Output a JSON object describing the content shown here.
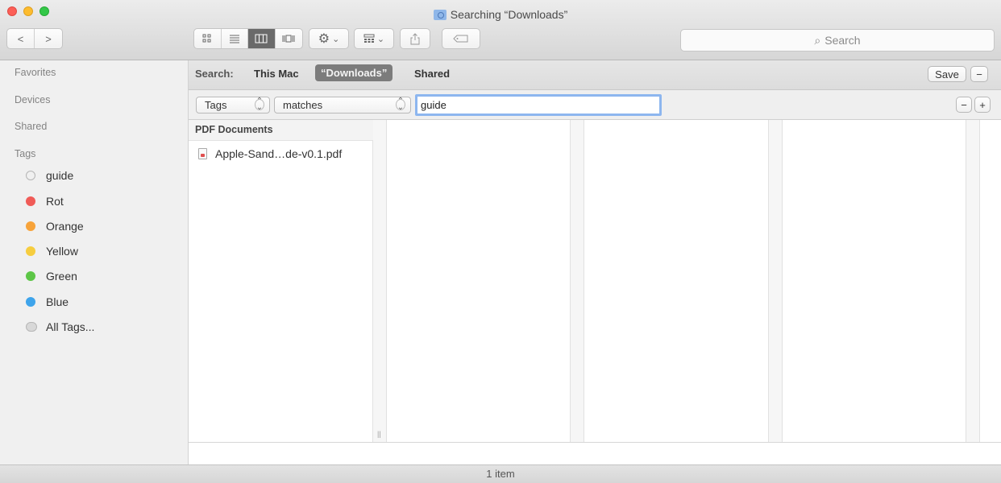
{
  "window": {
    "title": "Searching “Downloads”"
  },
  "toolbar": {
    "back_icon": "<",
    "forward_icon": ">",
    "view_icons": [
      "icon-view-icon",
      "list-view-icon",
      "column-view-icon",
      "cover-flow-icon"
    ],
    "action_caret": "⌄",
    "arrange_caret": "⌄",
    "search_placeholder": "Search"
  },
  "sidebar": {
    "sections": [
      "Favorites",
      "Devices",
      "Shared",
      "Tags"
    ],
    "tags": [
      {
        "label": "guide",
        "color": "none"
      },
      {
        "label": "Rot",
        "color": "#f05b57"
      },
      {
        "label": "Orange",
        "color": "#f7a33a"
      },
      {
        "label": "Yellow",
        "color": "#f6cd3f"
      },
      {
        "label": "Green",
        "color": "#5dc647"
      },
      {
        "label": "Blue",
        "color": "#3ea4eb"
      },
      {
        "label": "All Tags...",
        "color": "multi"
      }
    ]
  },
  "scope": {
    "label": "Search:",
    "options": [
      "This Mac",
      "“Downloads”",
      "Shared"
    ],
    "selected": "“Downloads”",
    "save_label": "Save",
    "remove_label": "−"
  },
  "criteria": {
    "attribute": "Tags",
    "operator": "matches",
    "value": "guide",
    "remove_label": "−",
    "add_label": "+"
  },
  "results": {
    "group_header": "PDF Documents",
    "files": [
      "Apple-Sand…de-v0.1.pdf"
    ]
  },
  "status": {
    "text": "1 item"
  }
}
